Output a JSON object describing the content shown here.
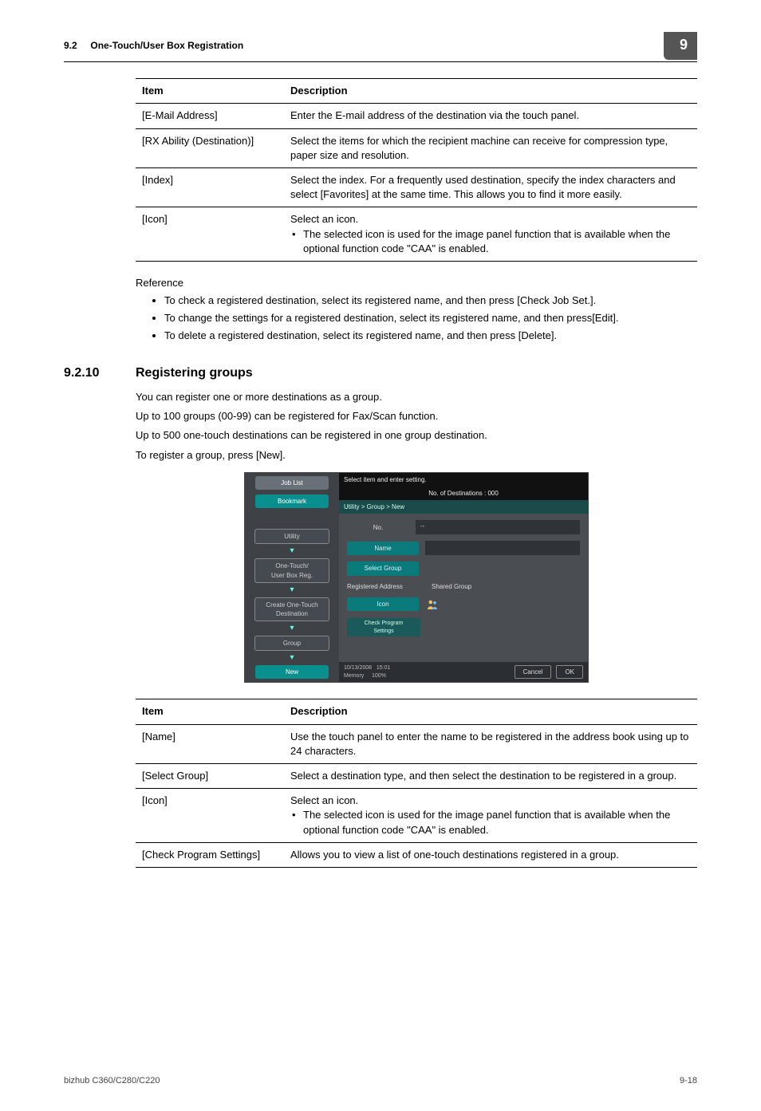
{
  "header": {
    "section_num": "9.2",
    "section_title": "One-Touch/User Box Registration",
    "chapter_badge": "9"
  },
  "table1": {
    "head_item": "Item",
    "head_desc": "Description",
    "rows": [
      {
        "item": "[E-Mail Address]",
        "desc": "Enter the E-mail address of the destination via the touch panel."
      },
      {
        "item": "[RX Ability (Destination)]",
        "desc": "Select the items for which the recipient machine can receive for compression type, paper size and resolution."
      },
      {
        "item": "[Index]",
        "desc": "Select the index. For a frequently used destination, specify the index characters and select [Favorites] at the same time. This allows you to find it more easily."
      },
      {
        "item": "[Icon]",
        "desc": "Select an icon.",
        "bullet": "The selected icon is used for the image panel function that is available when the optional function code \"CAA\" is enabled."
      }
    ]
  },
  "reference": {
    "label": "Reference",
    "items": [
      "To check a registered destination, select its registered name, and then press [Check Job Set.].",
      "To change the settings for a registered destination, select its registered name, and then press[Edit].",
      "To delete a registered destination, select its registered name, and then press [Delete]."
    ]
  },
  "section": {
    "num": "9.2.10",
    "title": "Registering groups",
    "paras": [
      "You can register one or more destinations as a group.",
      "Up to 100 groups (00-99) can be registered for Fax/Scan function.",
      "Up to 500 one-touch destinations can be registered in one group destination.",
      "To register a group, press [New]."
    ]
  },
  "screenshot": {
    "nav": {
      "joblist": "Job List",
      "bookmark": "Bookmark",
      "utility": "Utility",
      "onetouch": "One-Touch/\nUser Box Reg.",
      "create": "Create One-Touch\nDestination",
      "group": "Group",
      "new": "New"
    },
    "bar1": "Select item and enter setting.",
    "bar2": "No. of Destinations :   000",
    "breadcrumb": "Utility > Group > New",
    "fields": {
      "no": "No.",
      "no_val": "--",
      "name": "Name",
      "select_group": "Select Group",
      "reg_addr": "Registered Address",
      "shared": "Shared Group",
      "icon": "Icon",
      "check": "Check Program\nSettings"
    },
    "footer": {
      "date": "10/13/2008",
      "time": "15:01",
      "mem": "Memory",
      "pct": "100%",
      "cancel": "Cancel",
      "ok": "OK"
    }
  },
  "table2": {
    "head_item": "Item",
    "head_desc": "Description",
    "rows": [
      {
        "item": "[Name]",
        "desc": "Use the touch panel to enter the name to be registered in the address book using up to 24 characters."
      },
      {
        "item": "[Select Group]",
        "desc": "Select a destination type, and then select the destination to be registered in a group."
      },
      {
        "item": "[Icon]",
        "desc": "Select an icon.",
        "bullet": "The selected icon is used for the image panel function that is available when the optional function code \"CAA\" is enabled."
      },
      {
        "item": "[Check Program Settings]",
        "desc": "Allows you to view a list of one-touch destinations registered in a group."
      }
    ]
  },
  "footer": {
    "model": "bizhub C360/C280/C220",
    "page": "9-18"
  }
}
